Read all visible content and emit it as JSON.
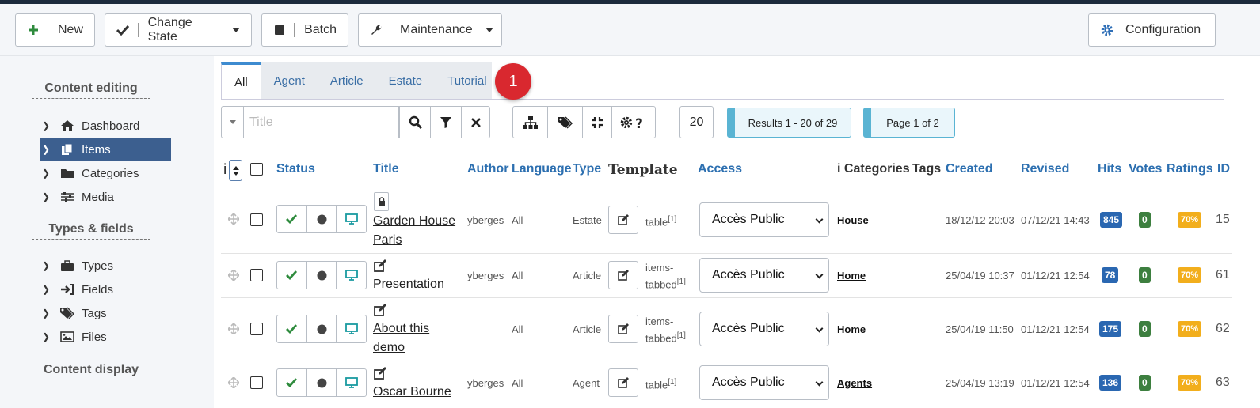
{
  "toolbar": {
    "new": "New",
    "change_state": "Change State",
    "batch": "Batch",
    "maintenance": "Maintenance",
    "configuration": "Configuration"
  },
  "sidebar": {
    "sections": [
      {
        "label": "Content editing"
      },
      {
        "label": "Types & fields"
      },
      {
        "label": "Content display"
      }
    ],
    "items": [
      {
        "label": "Dashboard"
      },
      {
        "label": "Items"
      },
      {
        "label": "Categories"
      },
      {
        "label": "Media"
      },
      {
        "label": "Types"
      },
      {
        "label": "Fields"
      },
      {
        "label": "Tags"
      },
      {
        "label": "Files"
      }
    ]
  },
  "tabs": [
    {
      "label": "All"
    },
    {
      "label": "Agent"
    },
    {
      "label": "Article"
    },
    {
      "label": "Estate"
    },
    {
      "label": "Tutorial"
    }
  ],
  "notification_count": "1",
  "filters": {
    "search_placeholder": "Title",
    "limit": "20",
    "results": "Results 1 - 20 of 29",
    "page": "Page 1 of 2"
  },
  "columns": {
    "status": "Status",
    "title": "Title",
    "author": "Author",
    "language": "Language",
    "type": "Type",
    "template": "Template",
    "access": "Access",
    "categories": "Categories",
    "tags": "Tags",
    "created": "Created",
    "revised": "Revised",
    "hits": "Hits",
    "votes": "Votes",
    "ratings": "Ratings",
    "id": "ID"
  },
  "rows": [
    {
      "title_line1": "Garden House",
      "title_line2": "Paris",
      "author": "yberges",
      "language": "All",
      "type": "Estate",
      "tmpl_line1": "table",
      "tmpl_line2": "",
      "tmpl_sup": "[1]",
      "access": "Accès Public",
      "category": "House",
      "created": "18/12/12 20:03",
      "revised": "07/12/21 14:43",
      "hits": "845",
      "votes": "0",
      "rating": "70%",
      "id": "15"
    },
    {
      "title_line1": "Presentation",
      "title_line2": "",
      "author": "yberges",
      "language": "All",
      "type": "Article",
      "tmpl_line1": "items-",
      "tmpl_line2": "tabbed",
      "tmpl_sup": "[1]",
      "access": "Accès Public",
      "category": "Home",
      "created": "25/04/19 10:37",
      "revised": "01/12/21 12:54",
      "hits": "78",
      "votes": "0",
      "rating": "70%",
      "id": "61"
    },
    {
      "title_line1": "About this",
      "title_line2": "demo",
      "author": "",
      "language": "All",
      "type": "Article",
      "tmpl_line1": "items-",
      "tmpl_line2": "tabbed",
      "tmpl_sup": "[1]",
      "access": "Accès Public",
      "category": "Home",
      "created": "25/04/19 11:50",
      "revised": "01/12/21 12:54",
      "hits": "175",
      "votes": "0",
      "rating": "70%",
      "id": "62"
    },
    {
      "title_line1": "Oscar Bourne",
      "title_line2": "",
      "author": "yberges",
      "language": "All",
      "type": "Agent",
      "tmpl_line1": "table",
      "tmpl_line2": "",
      "tmpl_sup": "[1]",
      "access": "Accès Public",
      "category": "Agents",
      "created": "25/04/19 13:19",
      "revised": "01/12/21 12:54",
      "hits": "136",
      "votes": "0",
      "rating": "70%",
      "id": "63"
    }
  ]
}
